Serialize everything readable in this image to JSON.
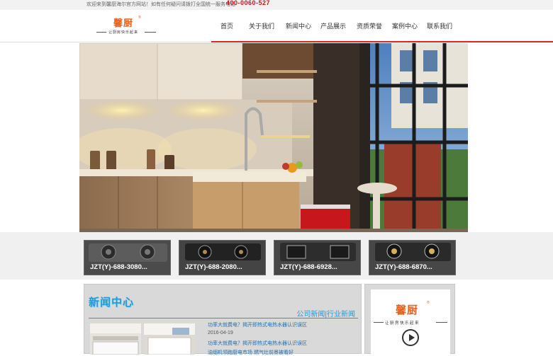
{
  "topbar": {
    "welcome": "欢迎来到馨厨海尔官方网站！如有任何疑问请拨打全国统一服务电话",
    "phone": "400-0060-527"
  },
  "logo": {
    "brand": "馨厨",
    "registered": "®",
    "slogan": "让厨房快乐起来"
  },
  "nav": {
    "items": [
      "首页",
      "关于我们",
      "新闻中心",
      "产品展示",
      "资质荣誉",
      "案例中心",
      "联系我们"
    ]
  },
  "banner": {
    "slides": 4,
    "active_slide": 1
  },
  "products": [
    {
      "label": "JZT(Y)-688-3080..."
    },
    {
      "label": "JZT(Y)-688-2080..."
    },
    {
      "label": "JZT(Y)-688-6928..."
    },
    {
      "label": "JZT(Y)-688-6870..."
    }
  ],
  "news": {
    "title": "新闻中心",
    "tabs": "公司新闻|行业新闻",
    "item1": "功率大就费电？揭开即热式电热水器认识误区",
    "date1": "2016-04-19",
    "item2": "功率大就费电？揭开即热式电热水器认识误区",
    "item3": "油烟机领跑厨电市场 燃气灶前景被看好"
  },
  "side": {
    "brand": "馨厨",
    "registered": "®",
    "slogan": "让厨房快乐起来"
  },
  "colors": {
    "accent_red": "#d9262b",
    "brand_orange": "#e8611a",
    "news_blue": "#1f9bd7"
  }
}
